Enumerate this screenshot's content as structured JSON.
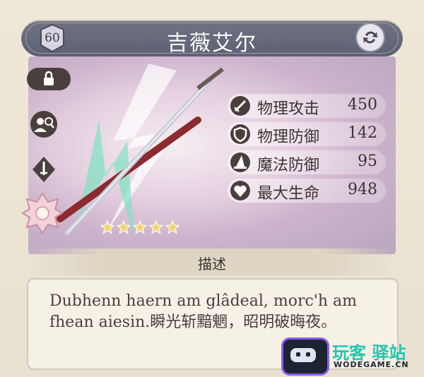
{
  "header": {
    "level": "60",
    "title": "吉薇艾尔"
  },
  "sidebar": {
    "icons": [
      "lock-icon",
      "character-search-icon",
      "sword-rank-icon",
      "flower-emblem-icon"
    ]
  },
  "stats": [
    {
      "label": "物理攻击",
      "value": "450",
      "icon": "sword-icon"
    },
    {
      "label": "物理防御",
      "value": "142",
      "icon": "shield-icon"
    },
    {
      "label": "魔法防御",
      "value": "95",
      "icon": "wizard-hat-icon"
    },
    {
      "label": "最大生命",
      "value": "948",
      "icon": "heart-icon"
    }
  ],
  "rarity": {
    "stars": 5,
    "max": 5
  },
  "description": {
    "title": "描述",
    "text": "Dubhenn haern am glâdeal, morc'h am fhean aiesin.瞬光斩黯魍，昭明破晦夜。"
  },
  "watermark": {
    "cn": "玩客 驿站",
    "en": "WODEGAME.CN"
  },
  "colors": {
    "title_bar": "#676b7c",
    "star": "#f2d36b",
    "text_dark": "#3b3333",
    "watermark_teal": "#22c5b0"
  }
}
